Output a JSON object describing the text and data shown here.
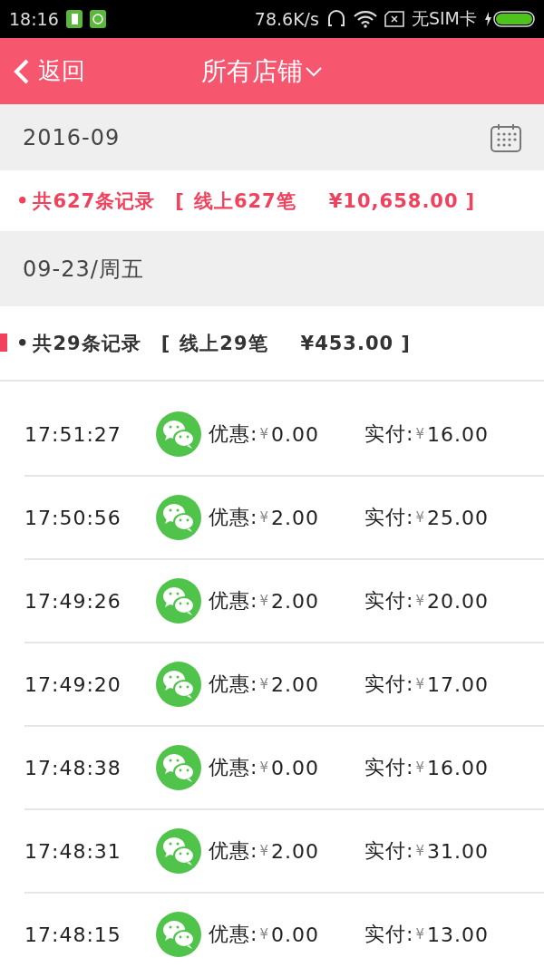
{
  "status_bar": {
    "time": "18:16",
    "speed": "78.6K/s",
    "carrier": "无SIM卡"
  },
  "header": {
    "back": "返回",
    "title": "所有店铺"
  },
  "month": {
    "label": "2016-09"
  },
  "month_summary": {
    "bullet": "•",
    "count": "共627条记录",
    "open": "[",
    "online": "线上627笔",
    "amount": "¥10,658.00",
    "close": "]"
  },
  "day": {
    "label": "09-23/周五"
  },
  "day_summary": {
    "bullet": "•",
    "count": "共29条记录",
    "open": "[",
    "online": "线上29笔",
    "amount": "¥453.00",
    "close": "]"
  },
  "rows": [
    {
      "time": "17:51:27",
      "discount_label": "优惠:",
      "discount_currency": "¥",
      "discount": "0.00",
      "paid_label": "实付:",
      "paid_currency": "¥",
      "paid": "16.00"
    },
    {
      "time": "17:50:56",
      "discount_label": "优惠:",
      "discount_currency": "¥",
      "discount": "2.00",
      "paid_label": "实付:",
      "paid_currency": "¥",
      "paid": "25.00"
    },
    {
      "time": "17:49:26",
      "discount_label": "优惠:",
      "discount_currency": "¥",
      "discount": "2.00",
      "paid_label": "实付:",
      "paid_currency": "¥",
      "paid": "20.00"
    },
    {
      "time": "17:49:20",
      "discount_label": "优惠:",
      "discount_currency": "¥",
      "discount": "2.00",
      "paid_label": "实付:",
      "paid_currency": "¥",
      "paid": "17.00"
    },
    {
      "time": "17:48:38",
      "discount_label": "优惠:",
      "discount_currency": "¥",
      "discount": "0.00",
      "paid_label": "实付:",
      "paid_currency": "¥",
      "paid": "16.00"
    },
    {
      "time": "17:48:31",
      "discount_label": "优惠:",
      "discount_currency": "¥",
      "discount": "2.00",
      "paid_label": "实付:",
      "paid_currency": "¥",
      "paid": "31.00"
    },
    {
      "time": "17:48:15",
      "discount_label": "优惠:",
      "discount_currency": "¥",
      "discount": "0.00",
      "paid_label": "实付:",
      "paid_currency": "¥",
      "paid": "13.00"
    }
  ]
}
